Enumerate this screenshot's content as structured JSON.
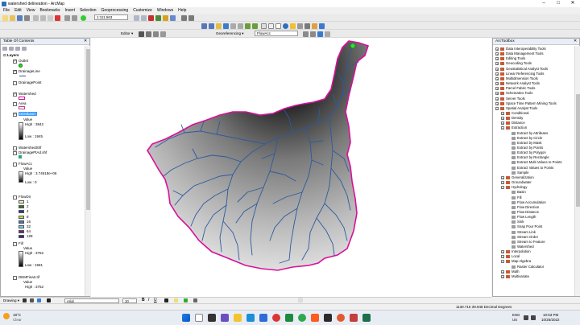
{
  "window": {
    "title": "watershed delineation - ArcMap",
    "minimize": "–",
    "maximize": "□",
    "close": "✕"
  },
  "menu": [
    "File",
    "Edit",
    "View",
    "Bookmarks",
    "Insert",
    "Selection",
    "Geoprocessing",
    "Customize",
    "Windows",
    "Help"
  ],
  "toolbar": {
    "scale": "1:111,563",
    "editor": "Editor ▾",
    "georeferencing": "Georeferencing ▾",
    "georef_layer": "FlowAcc"
  },
  "toc": {
    "title": "Table Of Contents",
    "close": "✕",
    "root": "Layers",
    "outlet": "Outlet",
    "drainage_line": "DrainageLine",
    "drainage_point": "DrainagePoint",
    "watershed": "Watershed",
    "area": "Area",
    "dem": "DEMbasin",
    "value": "Value",
    "high_dem": "High : 3842",
    "low_dem": "Low : 1945",
    "watershed_shp": "WatershedShf",
    "drainage_pt_shp": "DrainagePtAd.shf",
    "flowacc": "FlowAcc",
    "flowacc_value": "Value",
    "high_flowacc": "High : 3.74618e+06",
    "low_flowacc": "Low : 0",
    "flowdir": "FlowDir",
    "flowdir_values": [
      "1",
      "2",
      "4",
      "8",
      "16",
      "32",
      "64",
      "128"
    ],
    "flowdir_colors": [
      "#f3ebb4",
      "#3b6e2f",
      "#1f3b8c",
      "#c4d64a",
      "#3a7ac0",
      "#6fd0e0",
      "#6b2a7d",
      "#3a2a7c"
    ],
    "fill": "Fill",
    "fill_value": "Value",
    "high_fill": "High : 3752",
    "low_fill": "Low : 1581",
    "demfinal": "DEMFina2.tif",
    "demfinal_value": "Value",
    "high_demfinal": "High : 3752"
  },
  "toolbox": {
    "title": "ArcToolbox",
    "close": "✕",
    "items": [
      "Data Interoperability Tools",
      "Data Management Tools",
      "Editing Tools",
      "Geocoding Tools",
      "Geostatistical Analyst Tools",
      "Linear Referencing Tools",
      "Multidimension Tools",
      "Network Analyst Tools",
      "Parcel Fabric Tools",
      "Schematics Tools",
      "Server Tools",
      "Space Time Pattern Mining Tools",
      "Spatial Analyst Tools"
    ],
    "spatial": [
      "Conditional",
      "Density",
      "Distance",
      "Extraction"
    ],
    "extraction": [
      "Extract by Attributes",
      "Extract by Circle",
      "Extract by Mask",
      "Extract by Points",
      "Extract by Polygon",
      "Extract by Rectangle",
      "Extract Multi Values to Points",
      "Extract Values to Points",
      "Sample"
    ],
    "spatial2": [
      "Generalization",
      "Groundwater",
      "Hydrology"
    ],
    "hydrology": [
      "Basin",
      "Fill",
      "Flow Accumulation",
      "Flow Direction",
      "Flow Distance",
      "Flow Length",
      "Sink",
      "Snap Pour Point",
      "Stream Link",
      "Stream Order",
      "Stream to Feature",
      "Watershed"
    ],
    "spatial3": [
      "Interpolation",
      "Local",
      "Map Algebra"
    ],
    "map_algebra": [
      "Raster Calculator"
    ],
    "spatial4": [
      "Math",
      "Multivariate"
    ]
  },
  "drawing": {
    "label": "Drawing ▾",
    "font": "Arial",
    "size": "10"
  },
  "status": {
    "coords": "1130.715  39.948 Decimal Degrees"
  },
  "taskbar": {
    "temp": "18°C",
    "weather": "Clear",
    "lang": "ENG",
    "region": "US",
    "time": "10:53 PM",
    "date": "10/25/2022"
  },
  "colors": {
    "boundary": "#d6119a",
    "streams": "#2c5aa0",
    "outlet": "#2ee02e",
    "selection": "#3399ff"
  }
}
